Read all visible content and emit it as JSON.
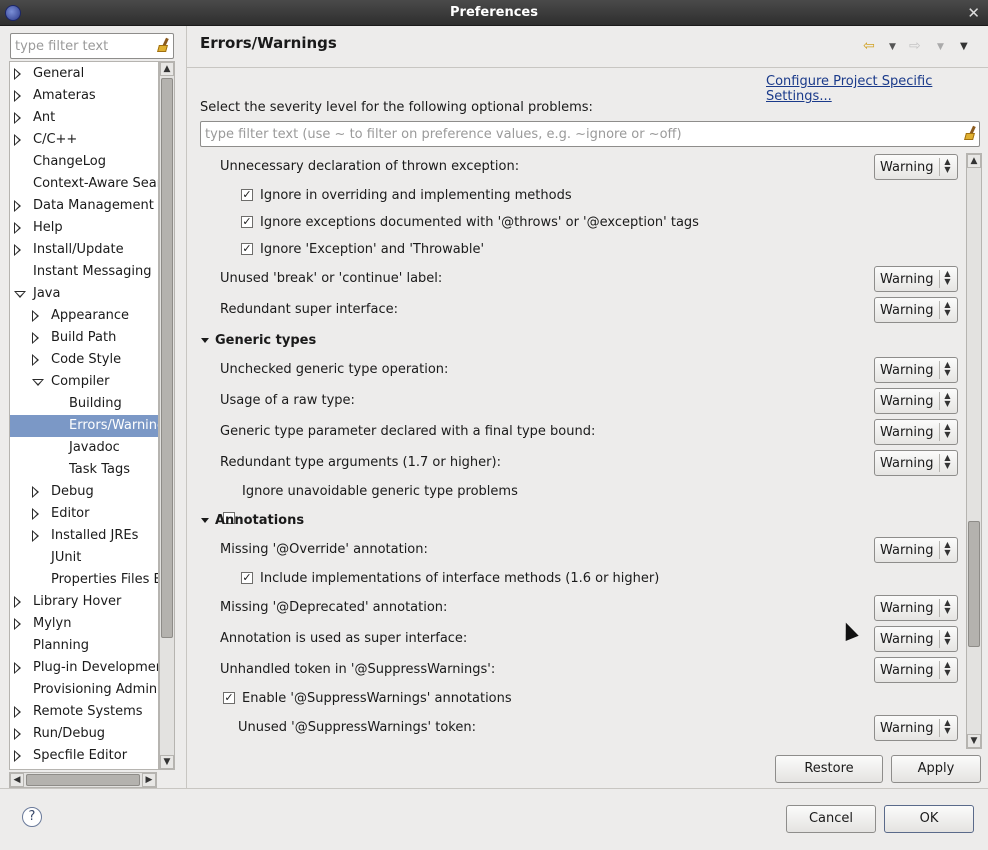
{
  "window": {
    "title": "Preferences",
    "close_label": "✕"
  },
  "left_filter": {
    "placeholder": "type filter text"
  },
  "tree": [
    {
      "label": "General",
      "expander": "right"
    },
    {
      "label": "Amateras",
      "expander": "right"
    },
    {
      "label": "Ant",
      "expander": "right"
    },
    {
      "label": "C/C++",
      "expander": "right"
    },
    {
      "label": "ChangeLog",
      "expander": "none"
    },
    {
      "label": "Context-Aware Searc",
      "expander": "none"
    },
    {
      "label": "Data Management",
      "expander": "right"
    },
    {
      "label": "Help",
      "expander": "right"
    },
    {
      "label": "Install/Update",
      "expander": "right"
    },
    {
      "label": "Instant Messaging",
      "expander": "none"
    },
    {
      "label": "Java",
      "expander": "down"
    },
    {
      "label": "Appearance",
      "expander": "right"
    },
    {
      "label": "Build Path",
      "expander": "right"
    },
    {
      "label": "Code Style",
      "expander": "right"
    },
    {
      "label": "Compiler",
      "expander": "down"
    },
    {
      "label": "Building",
      "expander": "none"
    },
    {
      "label": "Errors/Warnings",
      "expander": "none",
      "selected": true
    },
    {
      "label": "Javadoc",
      "expander": "none"
    },
    {
      "label": "Task Tags",
      "expander": "none"
    },
    {
      "label": "Debug",
      "expander": "right"
    },
    {
      "label": "Editor",
      "expander": "right"
    },
    {
      "label": "Installed JREs",
      "expander": "right"
    },
    {
      "label": "JUnit",
      "expander": "none"
    },
    {
      "label": "Properties Files E",
      "expander": "none"
    },
    {
      "label": "Library Hover",
      "expander": "right"
    },
    {
      "label": "Mylyn",
      "expander": "right"
    },
    {
      "label": "Planning",
      "expander": "none"
    },
    {
      "label": "Plug-in Development",
      "expander": "right"
    },
    {
      "label": "Provisioning Admin",
      "expander": "none"
    },
    {
      "label": "Remote Systems",
      "expander": "right"
    },
    {
      "label": "Run/Debug",
      "expander": "right"
    },
    {
      "label": "Specfile Editor",
      "expander": "right"
    }
  ],
  "page": {
    "title": "Errors/Warnings",
    "configure_link": "Configure Project Specific Settings...",
    "severity_label": "Select the severity level for the following optional problems:",
    "filter_placeholder": "type filter text (use ~ to filter on preference values, e.g. ~ignore or ~off)"
  },
  "content": {
    "unnecessary_thrown": {
      "label": "Unnecessary declaration of thrown exception:",
      "value": "Warning"
    },
    "cb_overriding": {
      "label": "Ignore in overriding and implementing methods",
      "checked": true
    },
    "cb_documented": {
      "label": "Ignore exceptions documented with '@throws' or '@exception' tags",
      "checked": true
    },
    "cb_exception": {
      "label": "Ignore 'Exception' and 'Throwable'",
      "checked": true
    },
    "unused_break": {
      "label": "Unused 'break' or 'continue' label:",
      "value": "Warning"
    },
    "redundant_super": {
      "label": "Redundant super interface:",
      "value": "Warning"
    },
    "section_generic": "Generic types",
    "unchecked_generic": {
      "label": "Unchecked generic type operation:",
      "value": "Warning"
    },
    "raw_type": {
      "label": "Usage of a raw type:",
      "value": "Warning"
    },
    "final_bound": {
      "label": "Generic type parameter declared with a final type bound:",
      "value": "Warning"
    },
    "redundant_args": {
      "label": "Redundant type arguments (1.7 or higher):",
      "value": "Warning"
    },
    "cb_unavoidable": {
      "label": "Ignore unavoidable generic type problems",
      "checked": false
    },
    "section_annotations": "Annotations",
    "missing_override": {
      "label": "Missing '@Override' annotation:",
      "value": "Warning"
    },
    "cb_include_impl": {
      "label": "Include implementations of interface methods (1.6 or higher)",
      "checked": true
    },
    "missing_deprecated": {
      "label": "Missing '@Deprecated' annotation:",
      "value": "Warning"
    },
    "annotation_super": {
      "label": "Annotation is used as super interface:",
      "value": "Warning"
    },
    "unhandled_token": {
      "label": "Unhandled token in '@SuppressWarnings':",
      "value": "Warning"
    },
    "cb_enable_suppress": {
      "label": "Enable '@SuppressWarnings' annotations",
      "checked": true
    },
    "unused_suppress": {
      "label": "Unused '@SuppressWarnings' token:",
      "value": "Warning"
    }
  },
  "buttons": {
    "restore_defaults": "Restore Defaults",
    "apply": "Apply",
    "cancel": "Cancel",
    "ok": "OK",
    "help": "?"
  }
}
